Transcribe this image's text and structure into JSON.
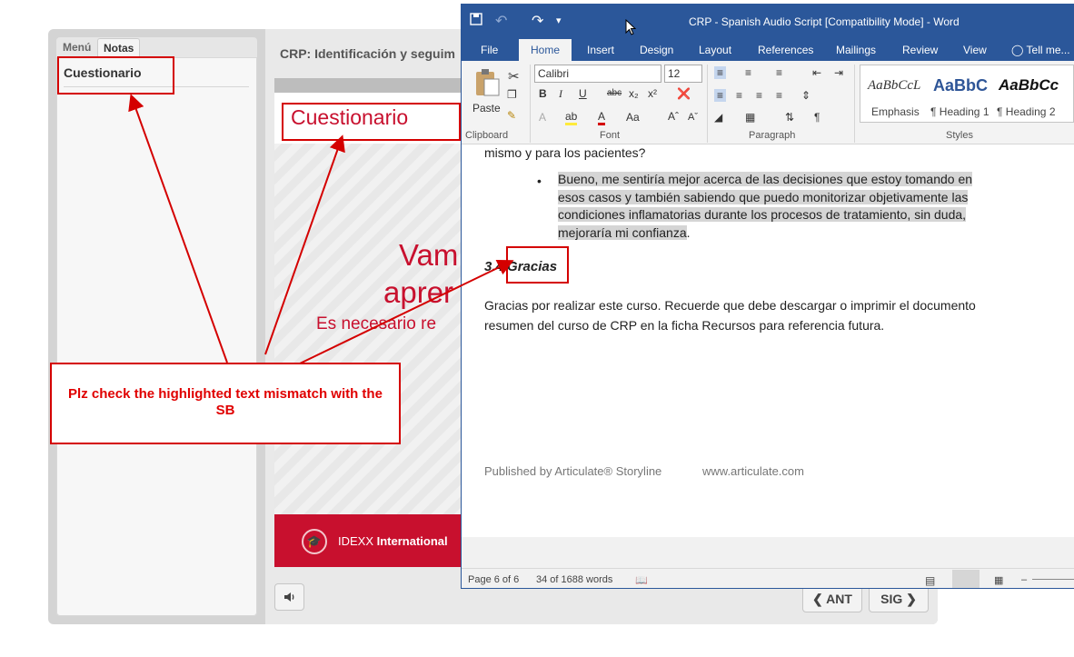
{
  "player": {
    "tab_menu": "Menú",
    "tab_notes": "Notas",
    "sidebar_item": "Cuestionario",
    "course_title": "CRP: Identificación y seguim",
    "slide_heading": "Cuestionario",
    "slide_big_line1": "Vam",
    "slide_big_line2": "aprer",
    "slide_small_line": "Es necesario re",
    "footer_brand_plain": "IDEXX ",
    "footer_brand_bold": "International",
    "prev_label": "ANT",
    "next_label": "SIG",
    "icons": {
      "volume": "speaker-icon",
      "prev": "chevron-left-icon",
      "next": "chevron-right-icon",
      "logo": "graduation-cap-icon"
    },
    "accent_color": "#c8102e"
  },
  "word": {
    "window_title": "CRP - Spanish Audio Script [Compatibility Mode] - Word",
    "tabs": [
      "File",
      "Home",
      "Insert",
      "Design",
      "Layout",
      "References",
      "Mailings",
      "Review",
      "View"
    ],
    "tell_me": "Tell me...",
    "ribbon": {
      "paste_label": "Paste",
      "font_name": "Calibri",
      "font_size": "12",
      "groups": [
        "Clipboard",
        "Font",
        "Paragraph",
        "Styles"
      ],
      "styles": [
        {
          "sample": "AaBbCcL",
          "name": "Emphasis"
        },
        {
          "sample": "AaBbC",
          "name": "¶ Heading 1"
        },
        {
          "sample": "AaBbCc",
          "name": "¶ Heading 2"
        }
      ]
    },
    "doc": {
      "line_prev": "mismo y para los pacientes?",
      "bullet_lines": [
        "Bueno, me sentiría mejor acerca de las decisiones que estoy tomando en",
        "esos casos y también sabiendo que puedo monitorizar objetivamente las",
        "condiciones inflamatorias durante los procesos de tratamiento, sin duda,"
      ],
      "bullet_last": "mejoraría mi confianza",
      "heading_number": "3.4",
      "heading_word": "Gracias",
      "para_line1": "Gracias por realizar este curso. Recuerde que debe descargar o imprimir el documento",
      "para_line2": "resumen del curso de CRP en la ficha Recursos para referencia futura.",
      "published": "Published by Articulate® Storyline",
      "site": "www.articulate.com"
    },
    "status": {
      "page": "Page 6 of 6",
      "words": "34 of 1688 words"
    }
  },
  "annotation": {
    "callout": "Plz check the highlighted text mismatch with the SB",
    "color": "#d40000"
  }
}
